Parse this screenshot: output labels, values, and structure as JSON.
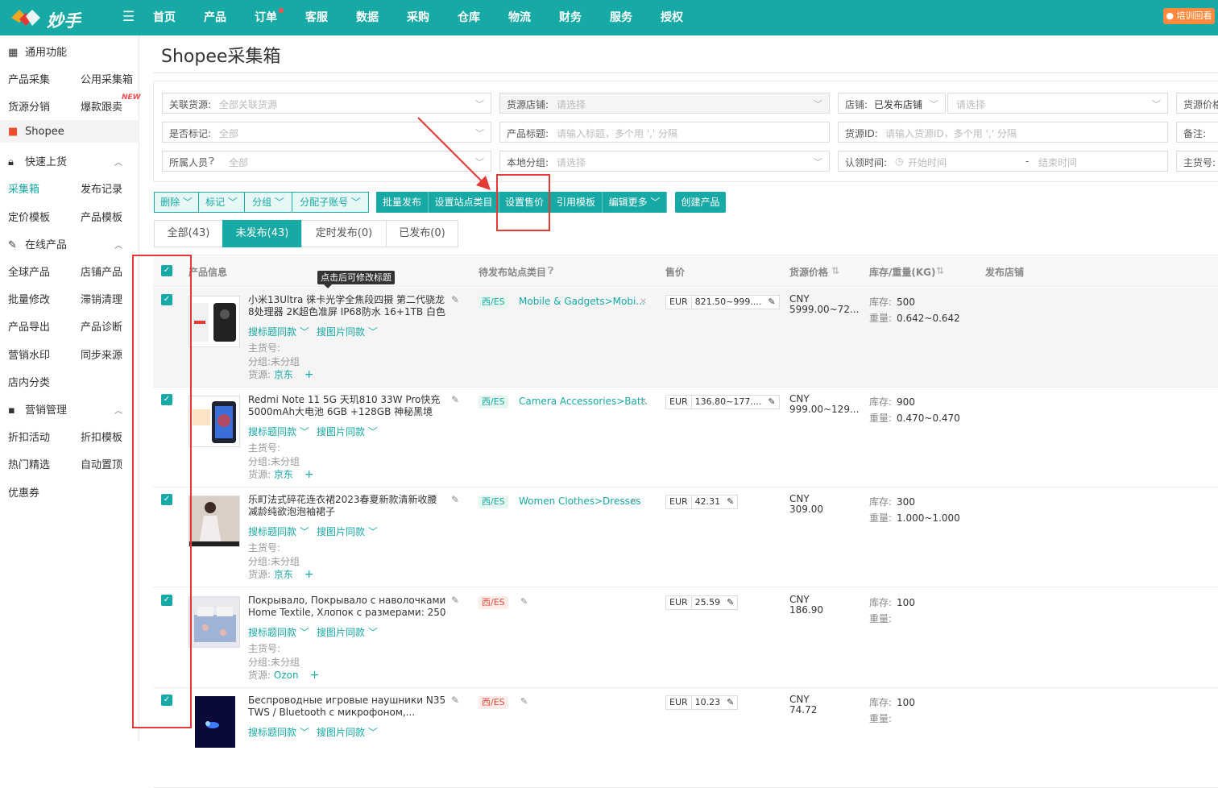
{
  "brand": "妙手",
  "nav": [
    "首页",
    "产品",
    "订单",
    "客服",
    "数据",
    "采购",
    "仓库",
    "物流",
    "财务",
    "服务",
    "授权"
  ],
  "training_badge": "培训回看",
  "sidebar": {
    "general": "通用功能",
    "links": [
      "产品采集",
      "公用采集箱",
      "货源分销",
      "爆款跟卖"
    ],
    "new_tag": "NEW",
    "platform": "Shopee",
    "quick_section": "快速上货",
    "quick_links": [
      "采集箱",
      "发布记录",
      "定价模板",
      "产品模板"
    ],
    "online_section": "在线产品",
    "online_links": [
      "全球产品",
      "店铺产品",
      "批量修改",
      "滞销清理",
      "产品导出",
      "产品诊断",
      "营销水印",
      "同步来源",
      "店内分类"
    ],
    "marketing_section": "营销管理",
    "marketing_links": [
      "折扣活动",
      "折扣模板",
      "热门精选",
      "自动置顶",
      "优惠券"
    ]
  },
  "page_title": "Shopee采集箱",
  "filters": {
    "linked_source_label": "关联货源:",
    "linked_source_ph": "全部关联货源",
    "source_shop_label": "货源店铺:",
    "source_shop_ph": "请选择",
    "shop_label": "店铺:",
    "shop_value": "已发布店铺",
    "shop_ph": "请选择",
    "source_price_label": "货源价格",
    "marked_label": "是否标记:",
    "marked_ph": "全部",
    "title_label": "产品标题:",
    "title_ph": "请输入标题，多个用 ',' 分隔",
    "source_id_label": "货源ID:",
    "source_id_ph": "请输入货源ID，多个用 ',' 分隔",
    "note_label": "备注:",
    "owner_label": "所属人员",
    "owner_ph": "全部",
    "group_label": "本地分组:",
    "group_ph": "请选择",
    "claim_label": "认领时间:",
    "claim_start": "开始时间",
    "claim_sep": "-",
    "claim_end": "结束时间",
    "sku_label": "主货号:"
  },
  "actions": {
    "delete": "删除",
    "mark": "标记",
    "group": "分组",
    "assign": "分配子账号",
    "batch_publish": "批量发布",
    "set_category": "设置站点类目",
    "set_price": "设置售价",
    "use_template": "引用模板",
    "edit_more": "编辑更多",
    "create": "创建产品"
  },
  "tabs": [
    "全部(43)",
    "未发布(43)",
    "定时发布(0)",
    "已发布(0)"
  ],
  "columns": {
    "product": "产品信息",
    "site_category": "待发布站点类目",
    "price": "售价",
    "source_price": "货源价格",
    "stock": "库存/重量(KG)",
    "shop": "发布店铺"
  },
  "tooltip": "点击后可修改标题",
  "labels": {
    "sim_title": "搜标题同款",
    "sim_image": "搜图片同款",
    "sku": "主货号:",
    "group": "分组:",
    "ungrouped": "未分组",
    "source": "货源:",
    "stock": "库存:",
    "weight": "重量:"
  },
  "rows": [
    {
      "title": "小米13Ultra 徕卡光学全焦段四摄 第二代骁龙8处理器 2K超色准屏 IP68防水 16+1TB 白色 ...",
      "site": "西/ES",
      "category": "Mobile & Gadgets>Mobi...",
      "currency": "EUR",
      "price": "821.50~999....",
      "src_cur": "CNY",
      "src_price": "5999.00~72...",
      "source": "京东",
      "stock": "500",
      "weight": "0.642~0.642"
    },
    {
      "title": "Redmi Note 11 5G 天玑810 33W Pro快充 5000mAh大电池 6GB +128GB 神秘黑境 智...",
      "site": "西/ES",
      "category": "Camera Accessories>Batt...",
      "currency": "EUR",
      "price": "136.80~177....",
      "src_cur": "CNY",
      "src_price": "999.00~129...",
      "source": "京东",
      "stock": "900",
      "weight": "0.470~0.470"
    },
    {
      "title": "乐町法式碎花连衣裙2023春夏新款清新收腰减龄纯欲泡泡袖裙子",
      "site": "西/ES",
      "category": "Women Clothes>Dresses",
      "currency": "EUR",
      "price": "42.31",
      "src_cur": "CNY",
      "src_price": "309.00",
      "source": "京东",
      "stock": "300",
      "weight": "1.000~1.000"
    },
    {
      "title": "Покрывало, Покрывало с наволочками Home Textile, Хлопок с размерами: 250 x...",
      "site": "西/ES",
      "category": "",
      "currency": "EUR",
      "price": "25.59",
      "src_cur": "CNY",
      "src_price": "186.90",
      "source": "Ozon",
      "stock": "100",
      "weight": ""
    },
    {
      "title": "Беспроводные игровые наушники N35 TWS / Bluetooth с микрофоном,...",
      "site": "西/ES",
      "category": "",
      "currency": "EUR",
      "price": "10.23",
      "src_cur": "CNY",
      "src_price": "74.72",
      "source": "",
      "stock": "100",
      "weight": ""
    }
  ],
  "colors": {
    "accent": "#16a9a5",
    "annotation": "#e53935",
    "train": "#ff8a3d"
  }
}
